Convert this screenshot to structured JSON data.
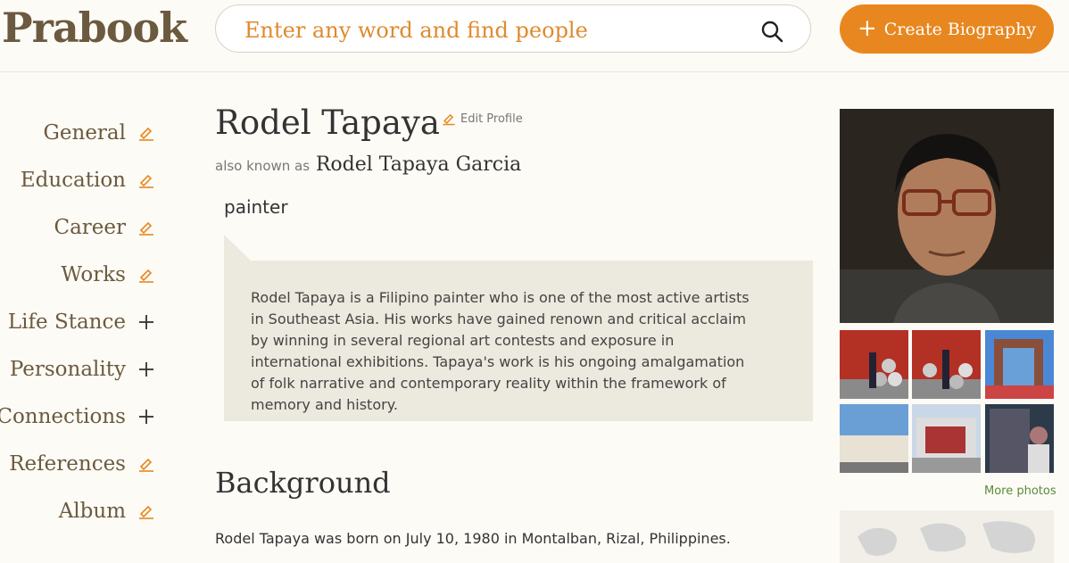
{
  "header": {
    "logo": "Prabook",
    "search_placeholder": "Enter any word and find people",
    "create_button": "Create Biography"
  },
  "sidebar": {
    "items": [
      {
        "label": "General",
        "icon": "edit-icon"
      },
      {
        "label": "Education",
        "icon": "edit-icon"
      },
      {
        "label": "Career",
        "icon": "edit-icon"
      },
      {
        "label": "Works",
        "icon": "edit-icon"
      },
      {
        "label": "Life Stance",
        "icon": "plus-icon"
      },
      {
        "label": "Personality",
        "icon": "plus-icon"
      },
      {
        "label": "Connections",
        "icon": "plus-icon"
      },
      {
        "label": "References",
        "icon": "edit-icon"
      },
      {
        "label": "Album",
        "icon": "edit-icon"
      }
    ]
  },
  "profile": {
    "name": "Rodel Tapaya",
    "edit_label": "Edit Profile",
    "aka_prefix": "also known as",
    "aka_name": "Rodel Tapaya Garcia",
    "occupation": "painter",
    "bio": "Rodel Tapaya is a Filipino painter who is one of the most active artists in Southeast Asia. His works have gained renown and critical acclaim by winning in several regional art contests and exposure in international exhibitions. Tapaya's work is his ongoing amalgamation of folk narrative and contemporary reality within the framework of memory and history."
  },
  "background": {
    "title": "Background",
    "text": "Rodel Tapaya was born on July 10, 1980 in Montalban, Rizal, Philippines."
  },
  "photos": {
    "more_label": "More photos"
  },
  "colors": {
    "accent": "#e8871f",
    "brand_brown": "#6b5a3f",
    "bio_bg": "#ece9de",
    "link_green": "#5a8a3a"
  }
}
